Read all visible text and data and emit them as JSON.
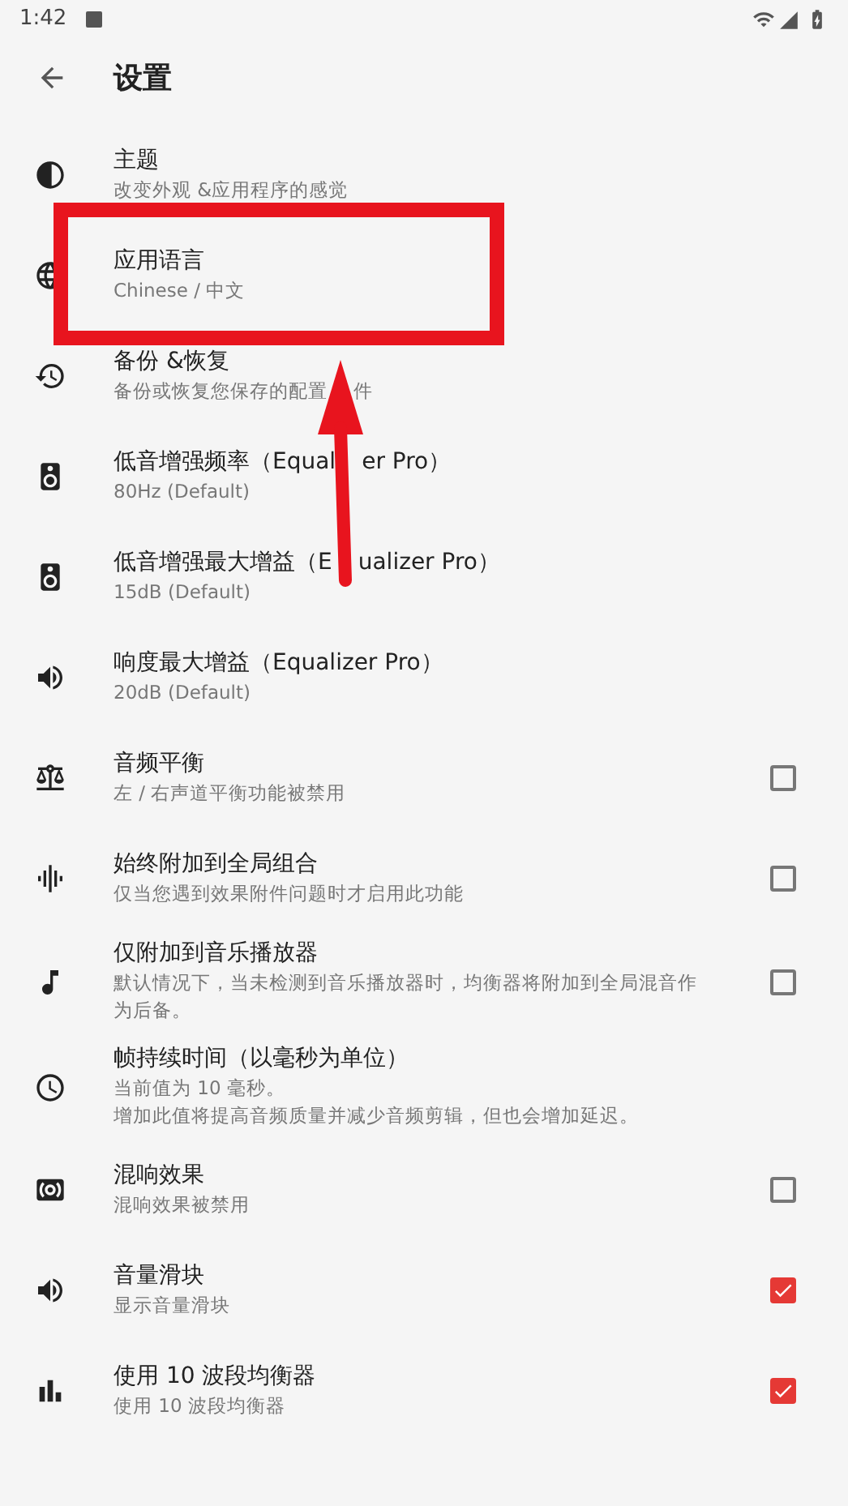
{
  "status_bar": {
    "time": "1:42"
  },
  "header": {
    "title": "设置"
  },
  "items": [
    {
      "kind": "plain",
      "title": [
        "主题"
      ],
      "subtitle": [
        [
          "改变外观 &应用程序的感觉"
        ]
      ]
    },
    {
      "kind": "plain",
      "title": [
        "应用语言"
      ],
      "subtitle": [
        [
          "Chinese / 中文"
        ]
      ]
    },
    {
      "kind": "plain",
      "title": [
        "备份 &恢复"
      ],
      "subtitle": [
        [
          "备份或恢复您保存的配置",
          "件"
        ]
      ]
    },
    {
      "kind": "plain",
      "title": [
        "低音增强频率（Equal",
        "er Pro）"
      ],
      "subtitle": [
        [
          "80Hz (Default)"
        ]
      ]
    },
    {
      "kind": "plain",
      "title": [
        "低音增强最大增益（E",
        "ualizer Pro）"
      ],
      "subtitle": [
        [
          "15dB (Default)"
        ]
      ]
    },
    {
      "kind": "plain",
      "title": [
        "响度最大增益（Equalizer Pro）"
      ],
      "subtitle": [
        [
          "20dB (Default)"
        ]
      ]
    },
    {
      "kind": "checkbox",
      "title": [
        "音频平衡"
      ],
      "subtitle": [
        [
          "左 / 右声道平衡功能被禁用"
        ]
      ],
      "checked": false
    },
    {
      "kind": "checkbox",
      "title": [
        "始终附加到全局组合"
      ],
      "subtitle": [
        [
          "仅当您遇到效果附件问题时才启用此功能"
        ]
      ],
      "checked": false
    },
    {
      "kind": "checkbox",
      "title": [
        "仅附加到音乐播放器"
      ],
      "subtitle": [
        [
          "默认情况下，当未检测到音乐播放器时，均衡器将附加到全局混音作为后备。"
        ]
      ],
      "checked": false
    },
    {
      "kind": "plain",
      "title": [
        "帧持续时间（以毫秒为单位）"
      ],
      "subtitle": [
        [
          "当前值为 10 毫秒。"
        ],
        [
          "增加此值将提高音频质量并减少音频剪辑，但也会增加延迟。"
        ]
      ]
    },
    {
      "kind": "checkbox",
      "title": [
        "混响效果"
      ],
      "subtitle": [
        [
          "混响效果被禁用"
        ]
      ],
      "checked": false
    },
    {
      "kind": "checkbox",
      "title": [
        "音量滑块"
      ],
      "subtitle": [
        [
          "显示音量滑块"
        ]
      ],
      "checked": true
    },
    {
      "kind": "checkbox",
      "title": [
        "使用 10 波段均衡器"
      ],
      "subtitle": [
        [
          "使用 10 波段均衡器"
        ]
      ],
      "checked": true
    }
  ]
}
